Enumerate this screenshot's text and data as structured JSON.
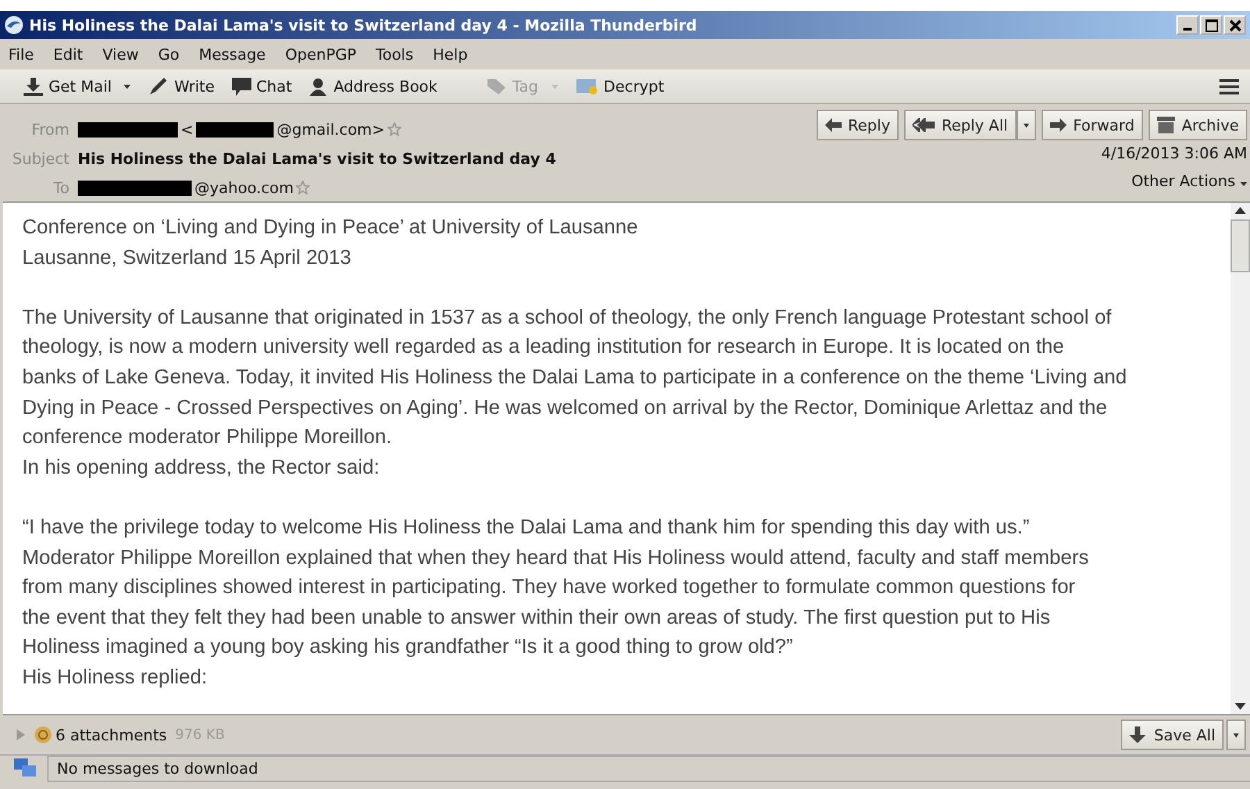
{
  "window": {
    "title": "His Holiness the Dalai Lama's visit to Switzerland day 4 - Mozilla Thunderbird"
  },
  "menu": [
    "File",
    "Edit",
    "View",
    "Go",
    "Message",
    "OpenPGP",
    "Tools",
    "Help"
  ],
  "toolbar": [
    {
      "label": "Get Mail",
      "kind": "getmail",
      "disabled": false
    },
    {
      "label": "Write",
      "kind": "write",
      "disabled": false
    },
    {
      "label": "Chat",
      "kind": "chat",
      "disabled": false
    },
    {
      "label": "Address Book",
      "kind": "addressbook",
      "disabled": false
    },
    {
      "label": "Tag",
      "kind": "tag",
      "disabled": true
    },
    {
      "label": "Decrypt",
      "kind": "decrypt",
      "disabled": false
    }
  ],
  "header": {
    "from_label": "From",
    "from_open": "<",
    "from_address": "@gmail.com>",
    "subject_label": "Subject",
    "subject": "His Holiness the Dalai Lama's visit to Switzerland day 4",
    "to_label": "To",
    "to_address": "@yahoo.com",
    "date": "4/16/2013 3:06 AM",
    "other_actions": "Other Actions"
  },
  "actions": [
    {
      "label": "Reply",
      "kind": "reply"
    },
    {
      "label": "Reply All",
      "kind": "replyall"
    },
    {
      "label": "Forward",
      "kind": "forward"
    },
    {
      "label": "Archive",
      "kind": "archive"
    }
  ],
  "body": [
    [
      "Conference on ‘Living and Dying in Peace’ at University of Lausanne",
      "Lausanne, Switzerland 15 April 2013"
    ],
    [
      "The University of Lausanne that originated in 1537 as a school of theology, the only French language Protestant school of",
      "theology, is now a modern university well regarded as a leading institution for research in Europe. It is located on the",
      "banks of Lake Geneva. Today, it invited His Holiness the Dalai Lama to participate in a conference on the theme ‘Living and",
      "Dying in Peace - Crossed Perspectives on Aging’. He was welcomed on arrival by the Rector, Dominique Arlettaz and the",
      "conference moderator Philippe Moreillon.",
      "In his opening address, the Rector said:"
    ],
    [
      "“I have the privilege today to welcome His Holiness the Dalai Lama and thank him for spending this day with us.”",
      "Moderator Philippe Moreillon explained that when they heard that His Holiness would attend, faculty and staff members",
      "from many disciplines showed interest in participating. They have worked together to formulate common questions for",
      "the event that they felt they had been unable to answer within their own areas of study. The first question put to His",
      "Holiness imagined a young boy asking his grandfather “Is it a good thing to grow old?”",
      "His Holiness replied:"
    ]
  ],
  "attachments": {
    "count": "6 attachments",
    "size": "976 KB",
    "save": "Save All"
  },
  "status_bar": "No messages to download"
}
